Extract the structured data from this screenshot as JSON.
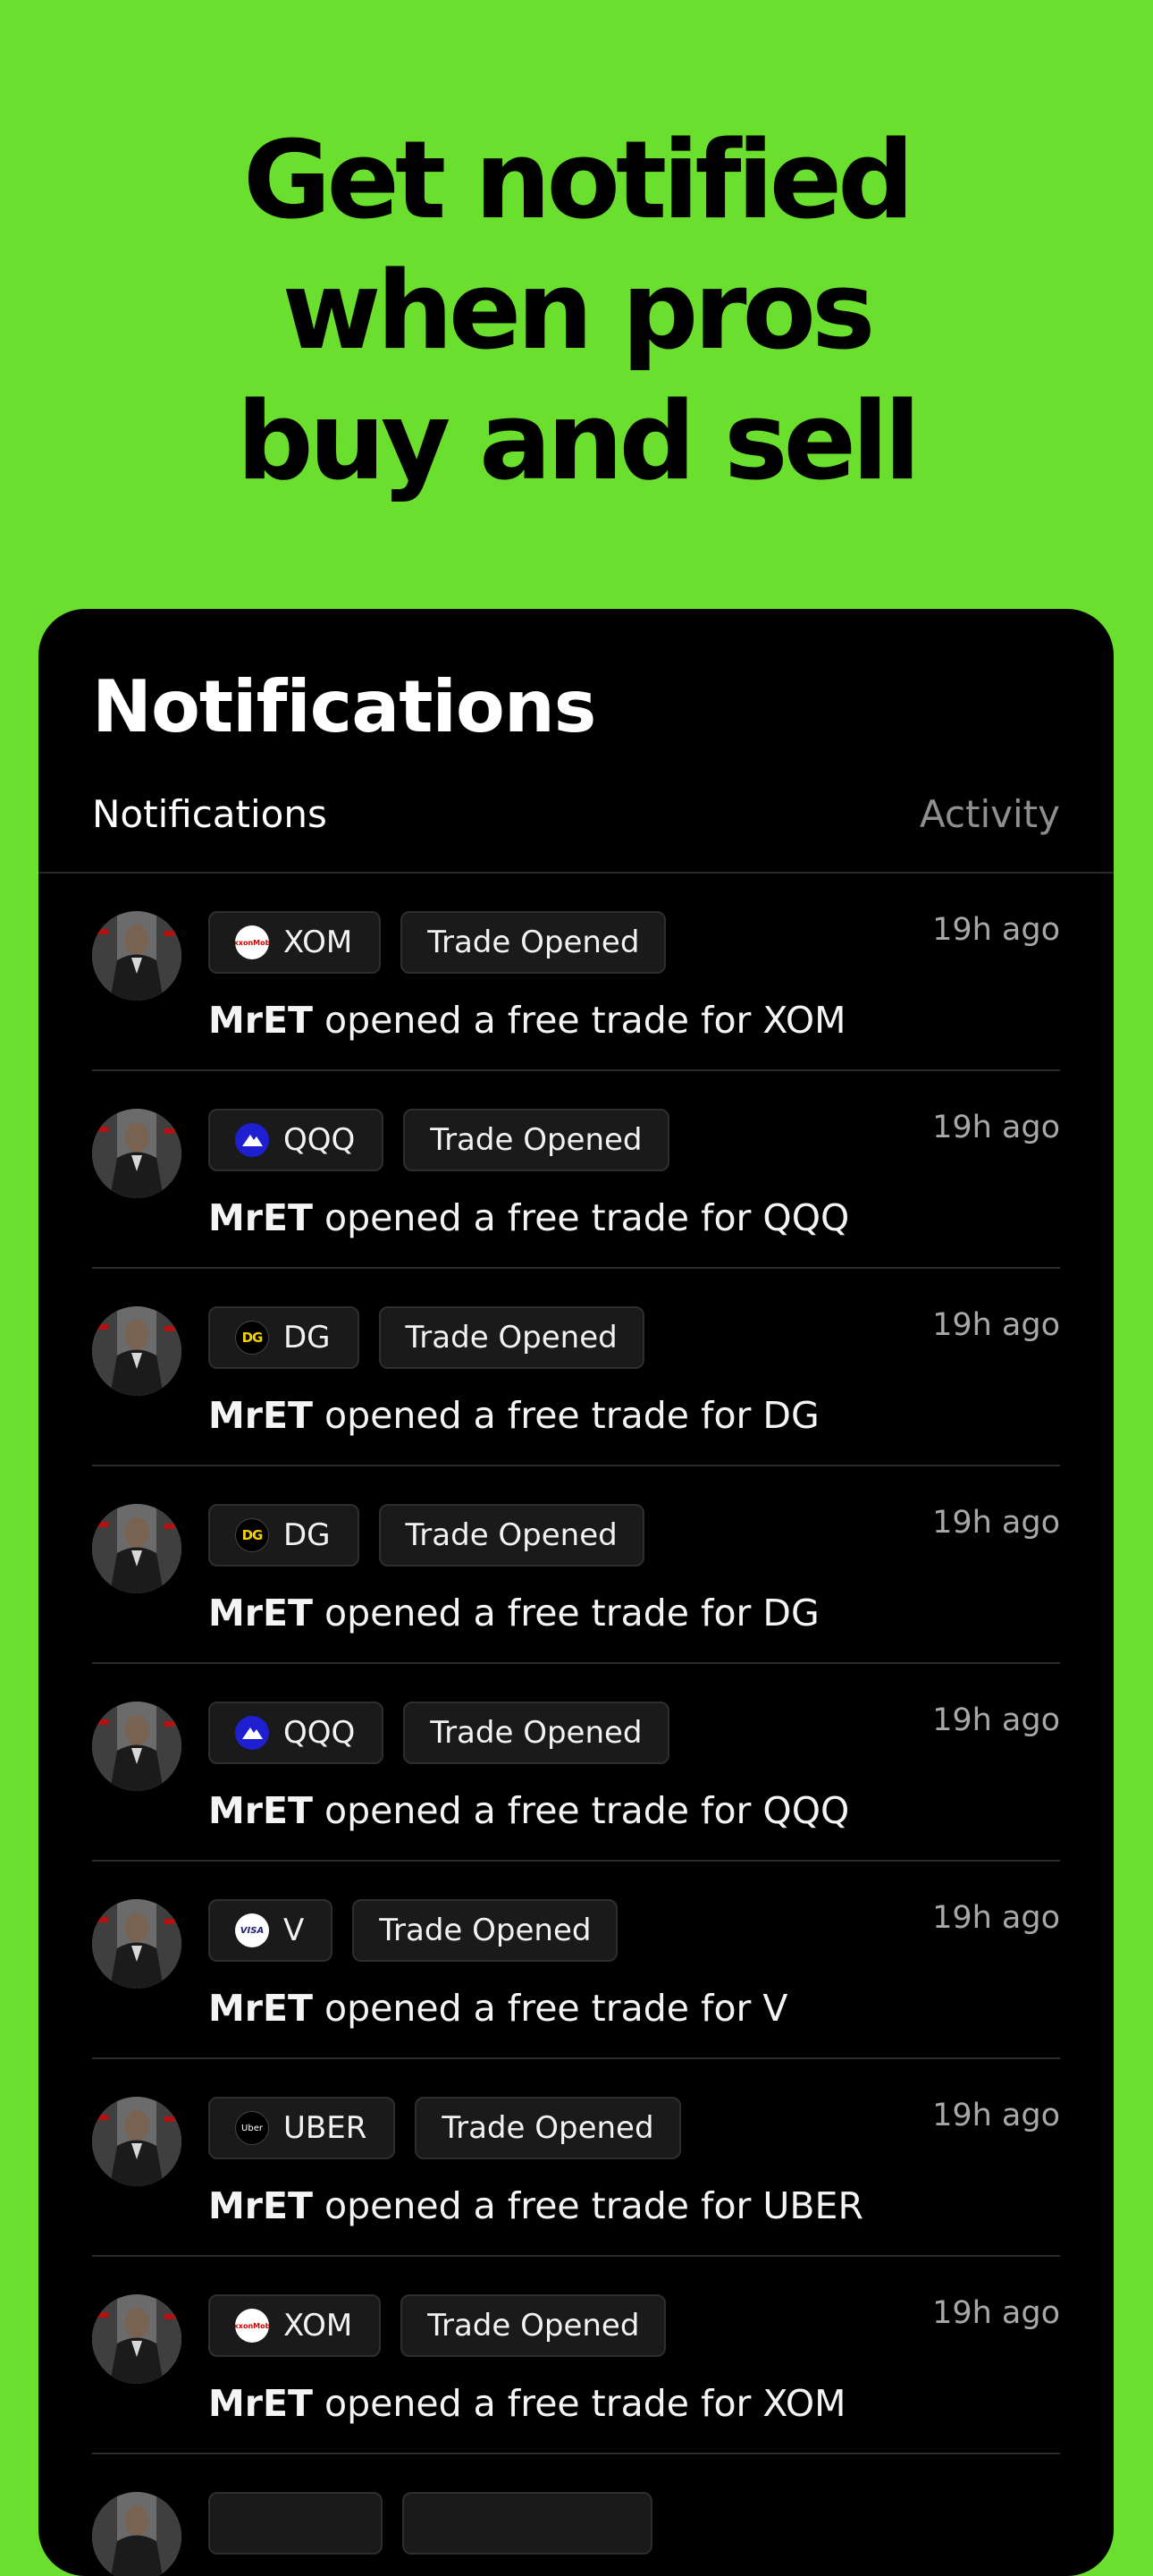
{
  "hero": {
    "line1": "Get notified",
    "line2": "when pros",
    "line3": "buy and sell"
  },
  "screen": {
    "title": "Notifications",
    "tabs": [
      {
        "label": "Notifications",
        "active": true
      },
      {
        "label": "Activity",
        "active": false
      }
    ]
  },
  "notifications": [
    {
      "ticker": "XOM",
      "ticker_logo_text": "ExxonMobil",
      "status": "Trade Opened",
      "time": "19h ago",
      "user": "MrET",
      "text": "opened a free trade for XOM"
    },
    {
      "ticker": "QQQ",
      "status": "Trade Opened",
      "time": "19h ago",
      "user": "MrET",
      "text": "opened a free trade for QQQ"
    },
    {
      "ticker": "DG",
      "ticker_logo_text": "DG",
      "status": "Trade Opened",
      "time": "19h ago",
      "user": "MrET",
      "text": "opened a free trade for DG"
    },
    {
      "ticker": "DG",
      "ticker_logo_text": "DG",
      "status": "Trade Opened",
      "time": "19h ago",
      "user": "MrET",
      "text": "opened a free trade for DG"
    },
    {
      "ticker": "QQQ",
      "status": "Trade Opened",
      "time": "19h ago",
      "user": "MrET",
      "text": "opened a free trade for QQQ"
    },
    {
      "ticker": "V",
      "ticker_logo_text": "VISA",
      "status": "Trade Opened",
      "time": "19h ago",
      "user": "MrET",
      "text": "opened a free trade for V"
    },
    {
      "ticker": "UBER",
      "ticker_logo_text": "Uber",
      "status": "Trade Opened",
      "time": "19h ago",
      "user": "MrET",
      "text": "opened a free trade for UBER"
    },
    {
      "ticker": "XOM",
      "ticker_logo_text": "ExxonMobil",
      "status": "Trade Opened",
      "time": "19h ago",
      "user": "MrET",
      "text": "opened a free trade for XOM"
    }
  ],
  "colors": {
    "background": "#6ADF2E",
    "card": "#000000",
    "chip": "#1a1a1a",
    "muted_text": "#a8a8a8"
  }
}
